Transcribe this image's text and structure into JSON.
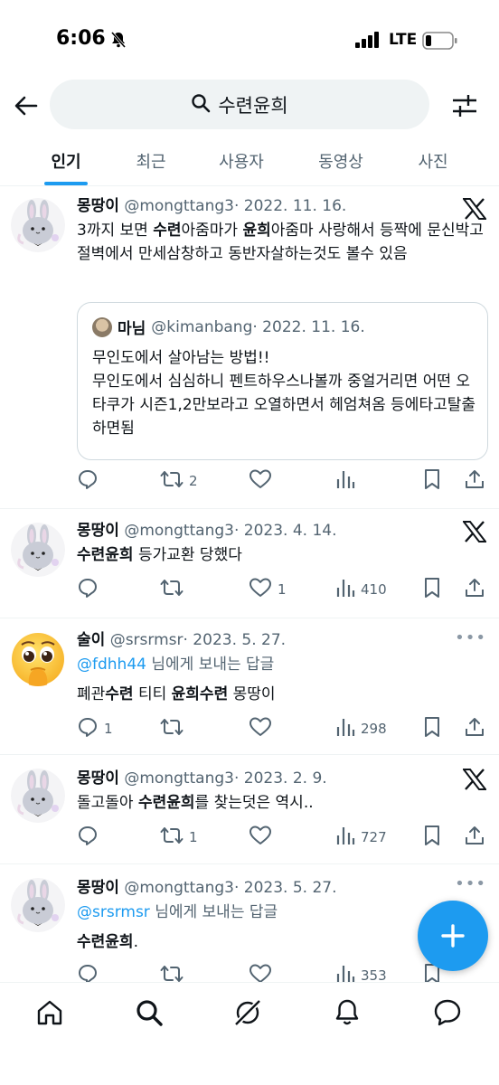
{
  "status_bar": {
    "time": "6:06",
    "network": "LTE"
  },
  "search": {
    "query": "수련윤희"
  },
  "tabs": [
    {
      "label": "인기"
    },
    {
      "label": "최근"
    },
    {
      "label": "사용자"
    },
    {
      "label": "동영상"
    },
    {
      "label": "사진"
    }
  ],
  "active_tab": "인기",
  "tweets": [
    {
      "name": "몽땅이",
      "handle": "@mongttang3",
      "date": "· 2022. 11. 16.",
      "text_parts": [
        "3까지 보면 ",
        "수련",
        "아줌마가 ",
        "윤희",
        "아줌마 사랑해서 등짝에 문신박고 절벽에서 만세삼창하고 동반자살하는것도 볼수 있음"
      ],
      "quote": {
        "name": "마님",
        "handle": "@kimanbang",
        "date": "· 2022. 11. 16.",
        "text": "무인도에서 살아남는 방법!!\n무인도에서 심심하니 펜트하우스나볼까 중얼거리면 어떤 오타쿠가  시즌1,2만보라고 오열하면서 헤엄쳐옴 등에타고탈출하면됨"
      },
      "retweets": "2",
      "likes": "",
      "views": ""
    },
    {
      "name": "몽땅이",
      "handle": "@mongttang3",
      "date": "· 2023. 4. 14.",
      "text_parts": [
        "수련윤희",
        " 등가교환 당했다"
      ],
      "replies": "",
      "retweets": "",
      "likes": "1",
      "views": "410"
    },
    {
      "name": "술이",
      "handle": "@srsrmsr",
      "date": "· 2023. 5. 27.",
      "reply_mention": "@fdhh44",
      "reply_suffix": " 님에게 보내는 답글",
      "text_parts": [
        "폐관",
        "수련",
        " 티티 ",
        "윤희수련",
        " 몽땅이"
      ],
      "replies": "1",
      "retweets": "",
      "likes": "",
      "views": "298"
    },
    {
      "name": "몽땅이",
      "handle": "@mongttang3",
      "date": "· 2023. 2. 9.",
      "text_parts": [
        "돌고돌아 ",
        "수련윤희",
        "를 찾는덧은 역시.."
      ],
      "retweets": "1",
      "likes": "",
      "views": "727"
    },
    {
      "name": "몽땅이",
      "handle": "@mongttang3",
      "date": "· 2023. 5. 27.",
      "reply_mention": "@srsrmsr",
      "reply_suffix": " 님에게 보내는 답글",
      "text_parts": [
        "수련윤희",
        "."
      ],
      "views": "353"
    }
  ],
  "colors": {
    "accent": "#1d9bf0",
    "text": "#0f1419",
    "muted": "#536471"
  }
}
